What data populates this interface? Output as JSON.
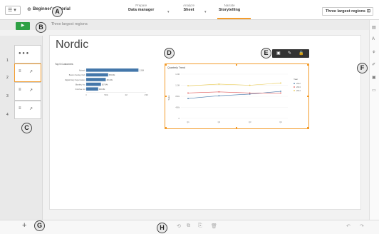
{
  "topbar": {
    "menu_label": "☰ ▾",
    "app_title": "Beginner's tutorial",
    "nav": [
      {
        "small": "Prepare",
        "big": "Data manager",
        "chev": "▾"
      },
      {
        "small": "Analyze",
        "big": "Sheet",
        "chev": "▾"
      },
      {
        "small": "Narrate",
        "big": "Storytelling",
        "chev": ""
      }
    ],
    "sheet_selector": "Three largest regions"
  },
  "story": {
    "title": "Three largest regions",
    "play_label": "▶"
  },
  "callouts": {
    "a": "A",
    "b": "B",
    "c": "C",
    "d": "D",
    "e": "E",
    "f": "F",
    "g": "G",
    "h": "H"
  },
  "thumbnails": [
    {
      "num": "1"
    },
    {
      "num": "2"
    },
    {
      "num": "3"
    },
    {
      "num": "4"
    }
  ],
  "slide": {
    "heading": "Nordic",
    "line_toolbar": [
      "▣",
      "✎",
      "🔒"
    ]
  },
  "chart_data": [
    {
      "type": "bar",
      "title": "Top 5 Customers",
      "categories": [
        "Nutravit",
        "Boston Sunday Club",
        "Digital Dairy Supermarket",
        "Blankety Inc",
        "Kimchee Ltd"
      ],
      "values": [
        1.31,
        0.55,
        0.49,
        0.37,
        0.3
      ],
      "value_labels": [
        "1.31M",
        "545.83k",
        "493.03k",
        "367.84k",
        "300.08k"
      ],
      "xlim": [
        0,
        1.5
      ],
      "x_ticks": [
        "0",
        "500k",
        "1M",
        "1.5M"
      ],
      "orientation": "horizontal"
    },
    {
      "type": "line",
      "title": "Quarterly Trend",
      "categories": [
        "Q1",
        "Q2",
        "Q3",
        "Q4"
      ],
      "ylabel": "Sales",
      "ylim": [
        0,
        1.6
      ],
      "y_ticks": [
        "0",
        "400k",
        "800k",
        "1.2M",
        "1.6M"
      ],
      "legend_title": "Year",
      "legend_position": "right",
      "series": [
        {
          "name": "2012",
          "values": [
            0.72,
            0.82,
            0.88,
            0.98
          ],
          "color": "#4477aa"
        },
        {
          "name": "2013",
          "values": [
            0.92,
            0.96,
            0.92,
            0.92
          ],
          "color": "#e05b5b"
        },
        {
          "name": "2014",
          "values": [
            1.18,
            1.24,
            1.2,
            1.28
          ],
          "color": "#e8c84c"
        }
      ]
    }
  ],
  "colors": {
    "accent": "#f39c2c",
    "play": "#2ea044",
    "bar": "#4477aa"
  }
}
